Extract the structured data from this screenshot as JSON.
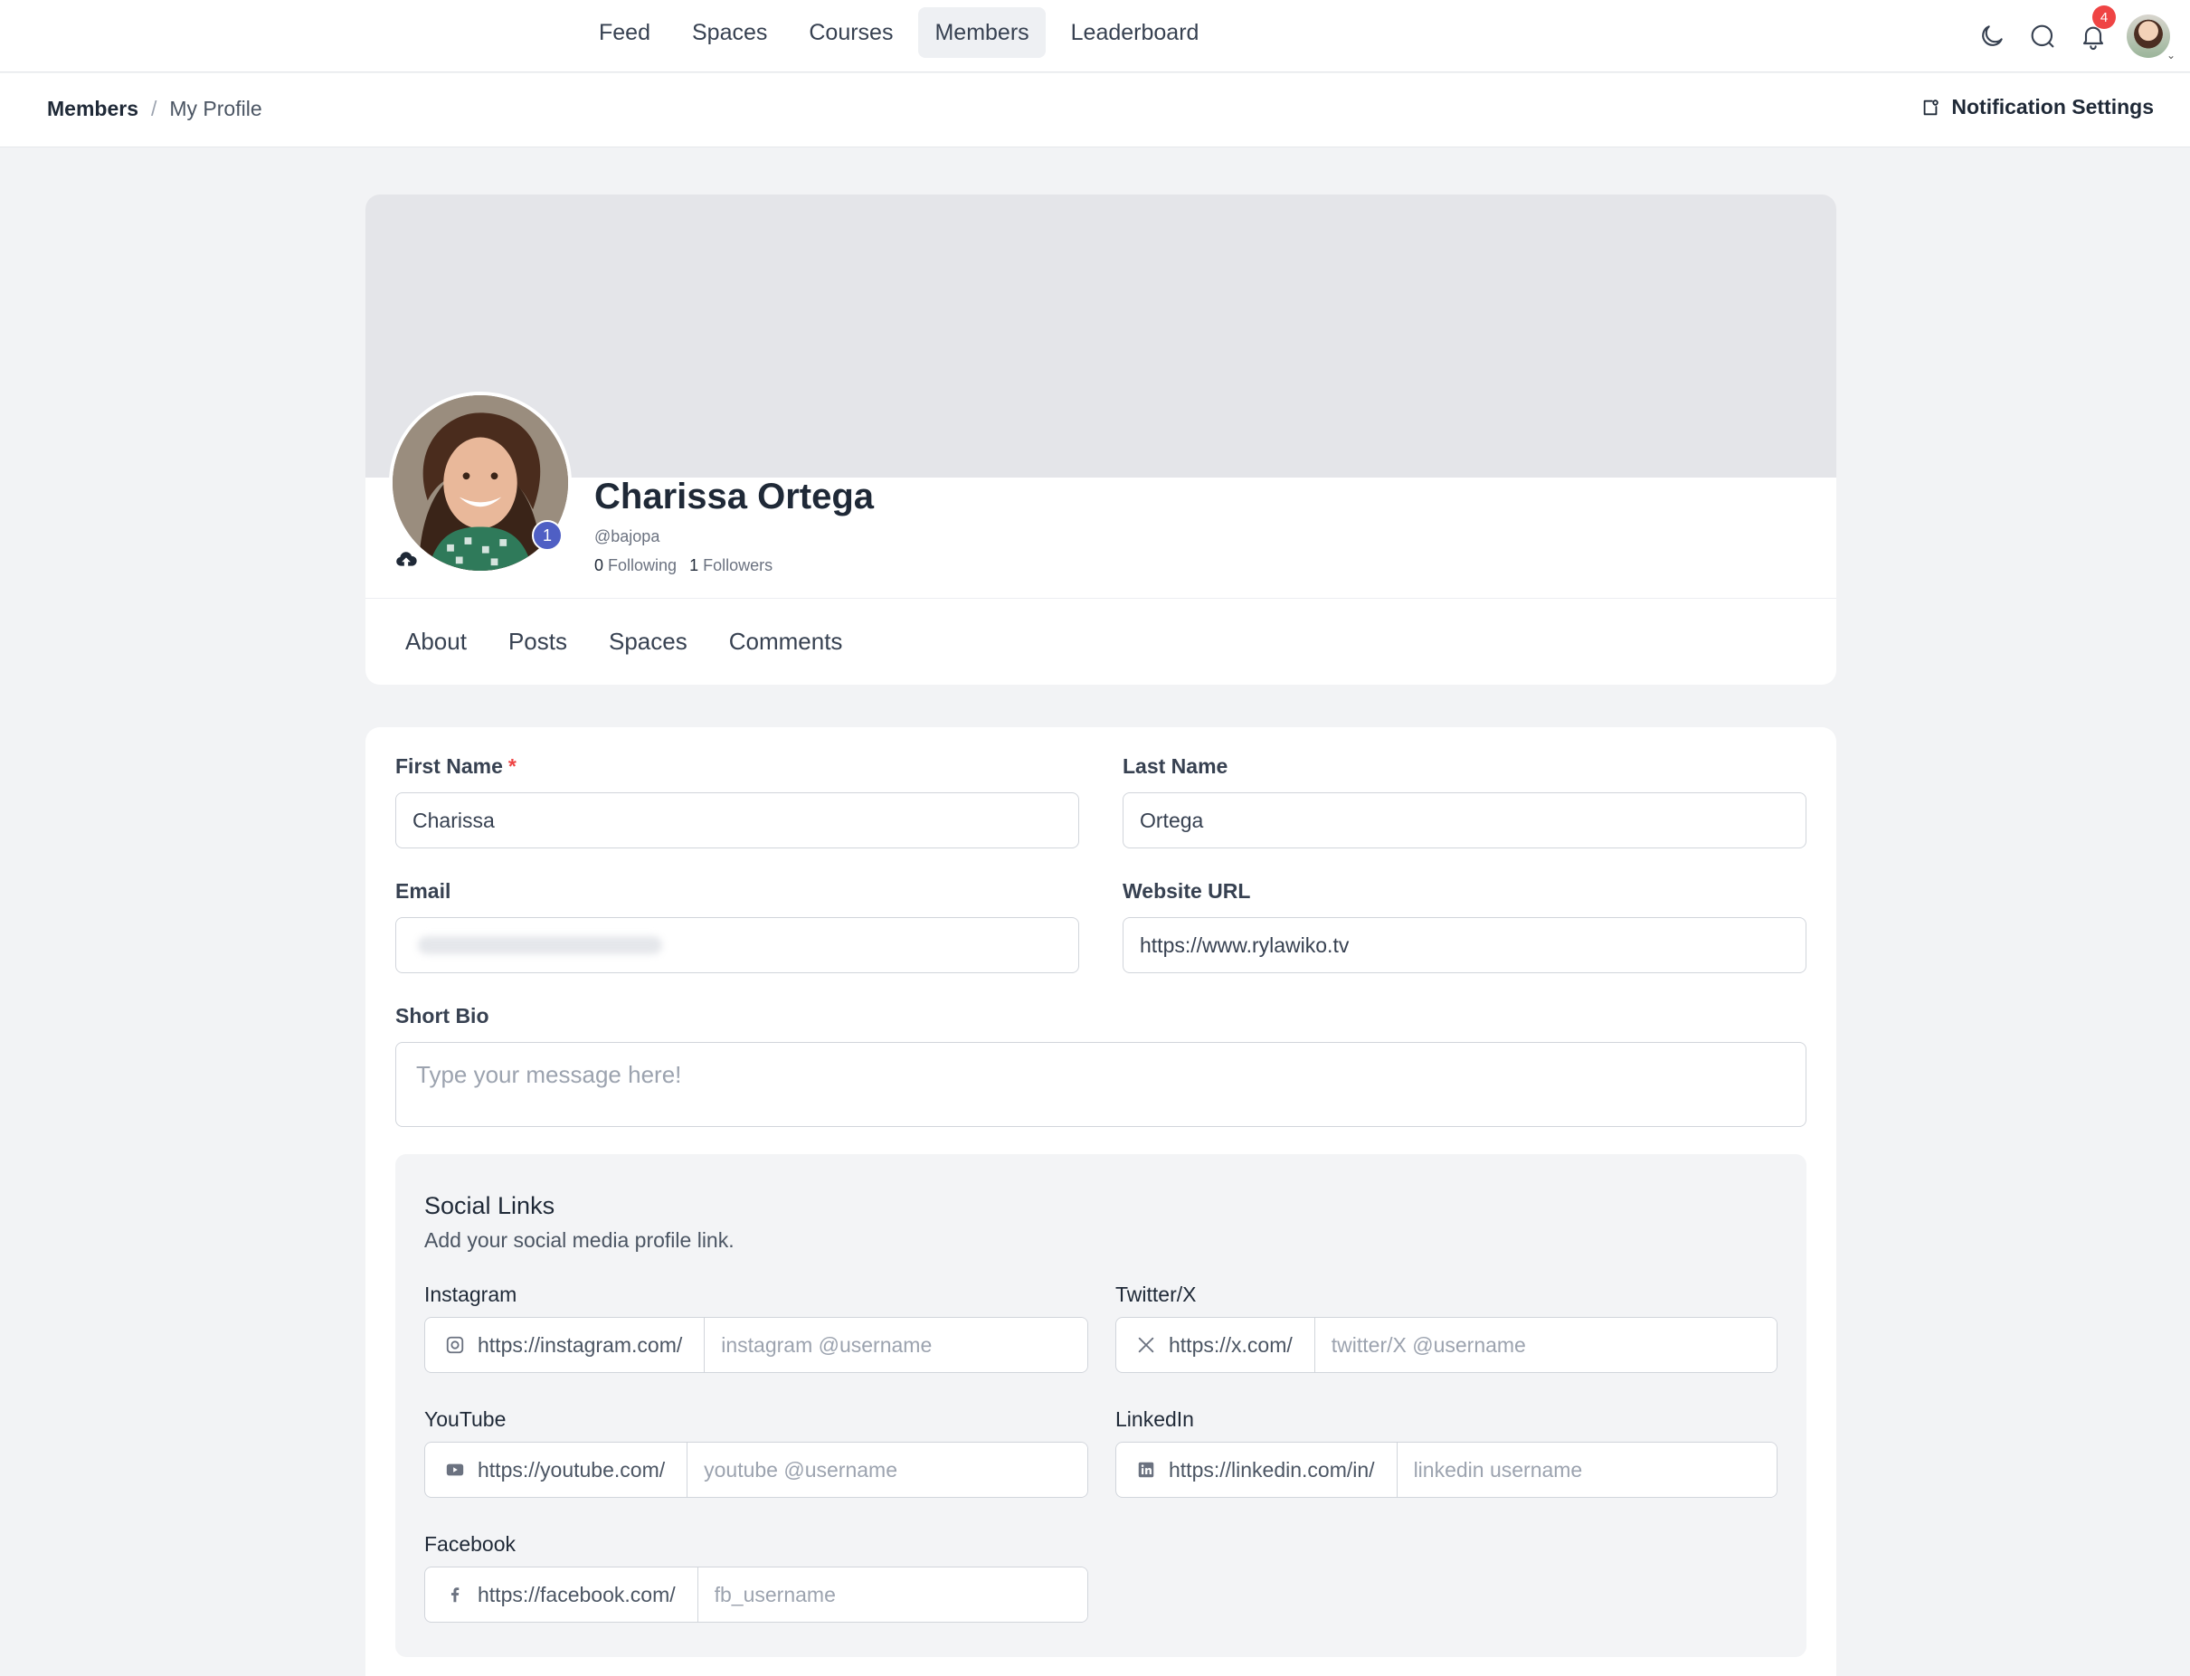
{
  "nav": {
    "items": [
      {
        "label": "Feed",
        "active": false
      },
      {
        "label": "Spaces",
        "active": false
      },
      {
        "label": "Courses",
        "active": false
      },
      {
        "label": "Members",
        "active": true
      },
      {
        "label": "Leaderboard",
        "active": false
      }
    ],
    "notification_count": "4",
    "icons": [
      "moon-icon",
      "search-icon",
      "bell-icon",
      "user-avatar"
    ]
  },
  "breadcrumb": {
    "root": "Members",
    "separator": "/",
    "current": "My Profile"
  },
  "notification_settings_label": "Notification Settings",
  "profile": {
    "name": "Charissa Ortega",
    "handle": "@bajopa",
    "following_count": "0",
    "following_label": "Following",
    "followers_count": "1",
    "followers_label": "Followers",
    "level": "1",
    "tabs": [
      "About",
      "Posts",
      "Spaces",
      "Comments"
    ]
  },
  "form": {
    "first_name_label": "First Name",
    "first_name_required": "*",
    "first_name_value": "Charissa",
    "last_name_label": "Last Name",
    "last_name_value": "Ortega",
    "email_label": "Email",
    "website_label": "Website URL",
    "website_value": "https://www.rylawiko.tv",
    "bio_label": "Short Bio",
    "bio_placeholder": "Type your message here!"
  },
  "social": {
    "title": "Social Links",
    "subtitle": "Add your social media profile link.",
    "instagram": {
      "label": "Instagram",
      "prefix": "https://instagram.com/",
      "placeholder": "instagram @username"
    },
    "twitter": {
      "label": "Twitter/X",
      "prefix": "https://x.com/",
      "placeholder": "twitter/X @username"
    },
    "youtube": {
      "label": "YouTube",
      "prefix": "https://youtube.com/",
      "placeholder": "youtube @username"
    },
    "linkedin": {
      "label": "LinkedIn",
      "prefix": "https://linkedin.com/in/",
      "placeholder": "linkedin username"
    },
    "facebook": {
      "label": "Facebook",
      "prefix": "https://facebook.com/",
      "placeholder": "fb_username"
    }
  },
  "colors": {
    "accent": "#4f5fc4",
    "badge": "#ef4444",
    "cover": "#e4e5e9",
    "page_bg": "#f2f3f5"
  }
}
